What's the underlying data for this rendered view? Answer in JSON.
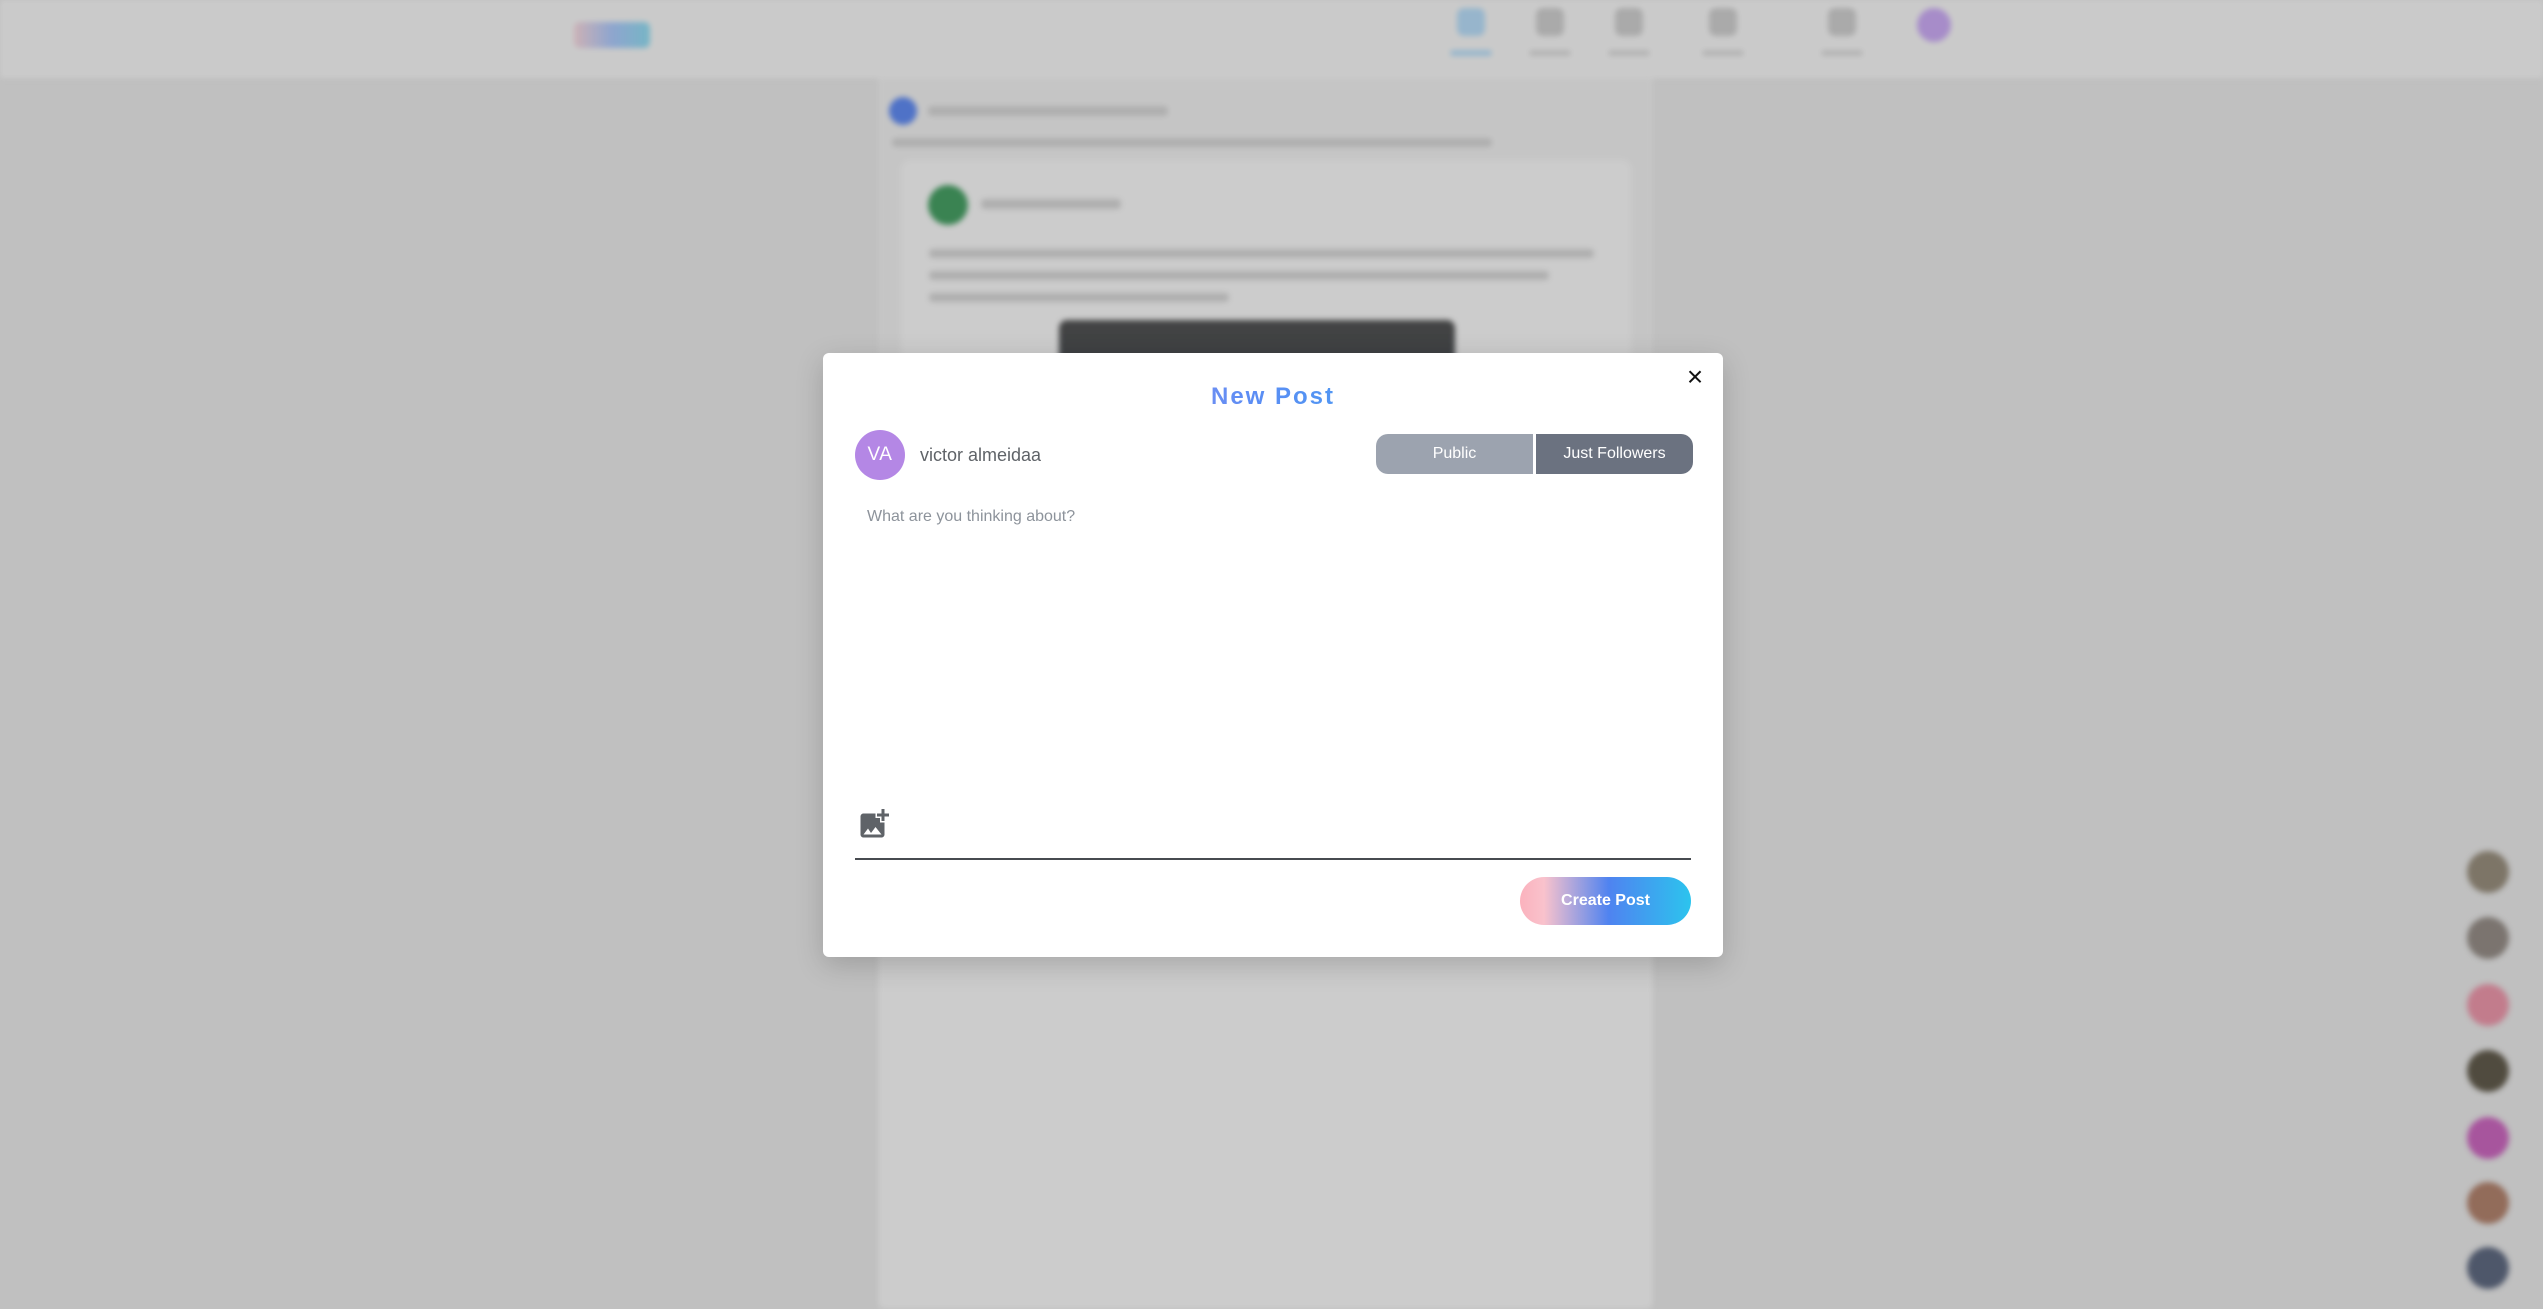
{
  "modal": {
    "title": "New Post",
    "author": {
      "initials": "VA",
      "name": "victor almeidaa"
    },
    "visibility": {
      "public_label": "Public",
      "followers_label": "Just Followers"
    },
    "textarea": {
      "placeholder": "What are you thinking about?"
    },
    "create_button_label": "Create Post",
    "close_icon": "close-icon",
    "add_image_icon": "add-photo-icon"
  },
  "colors": {
    "public": "#9ca3af",
    "followers": "#6b7280",
    "avatar": "#b487e5"
  }
}
